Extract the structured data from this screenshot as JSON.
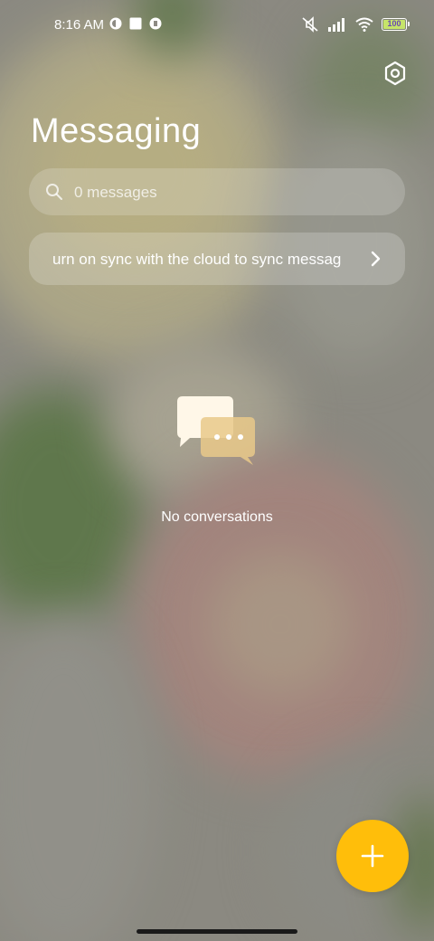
{
  "status_bar": {
    "time": "8:16 AM",
    "battery": "100",
    "icons": [
      "vpn-icon",
      "square-icon",
      "vpn-icon",
      "mute-icon",
      "signal-icon",
      "wifi-icon",
      "battery-icon"
    ]
  },
  "header": {
    "title": "Messaging",
    "settings_icon": "gear-icon"
  },
  "search": {
    "placeholder": "0 messages"
  },
  "sync_banner": {
    "text": "urn on sync with the cloud to sync messag"
  },
  "empty_state": {
    "text": "No conversations"
  },
  "fab": {
    "icon": "plus-icon",
    "color": "#ffbe0a"
  }
}
